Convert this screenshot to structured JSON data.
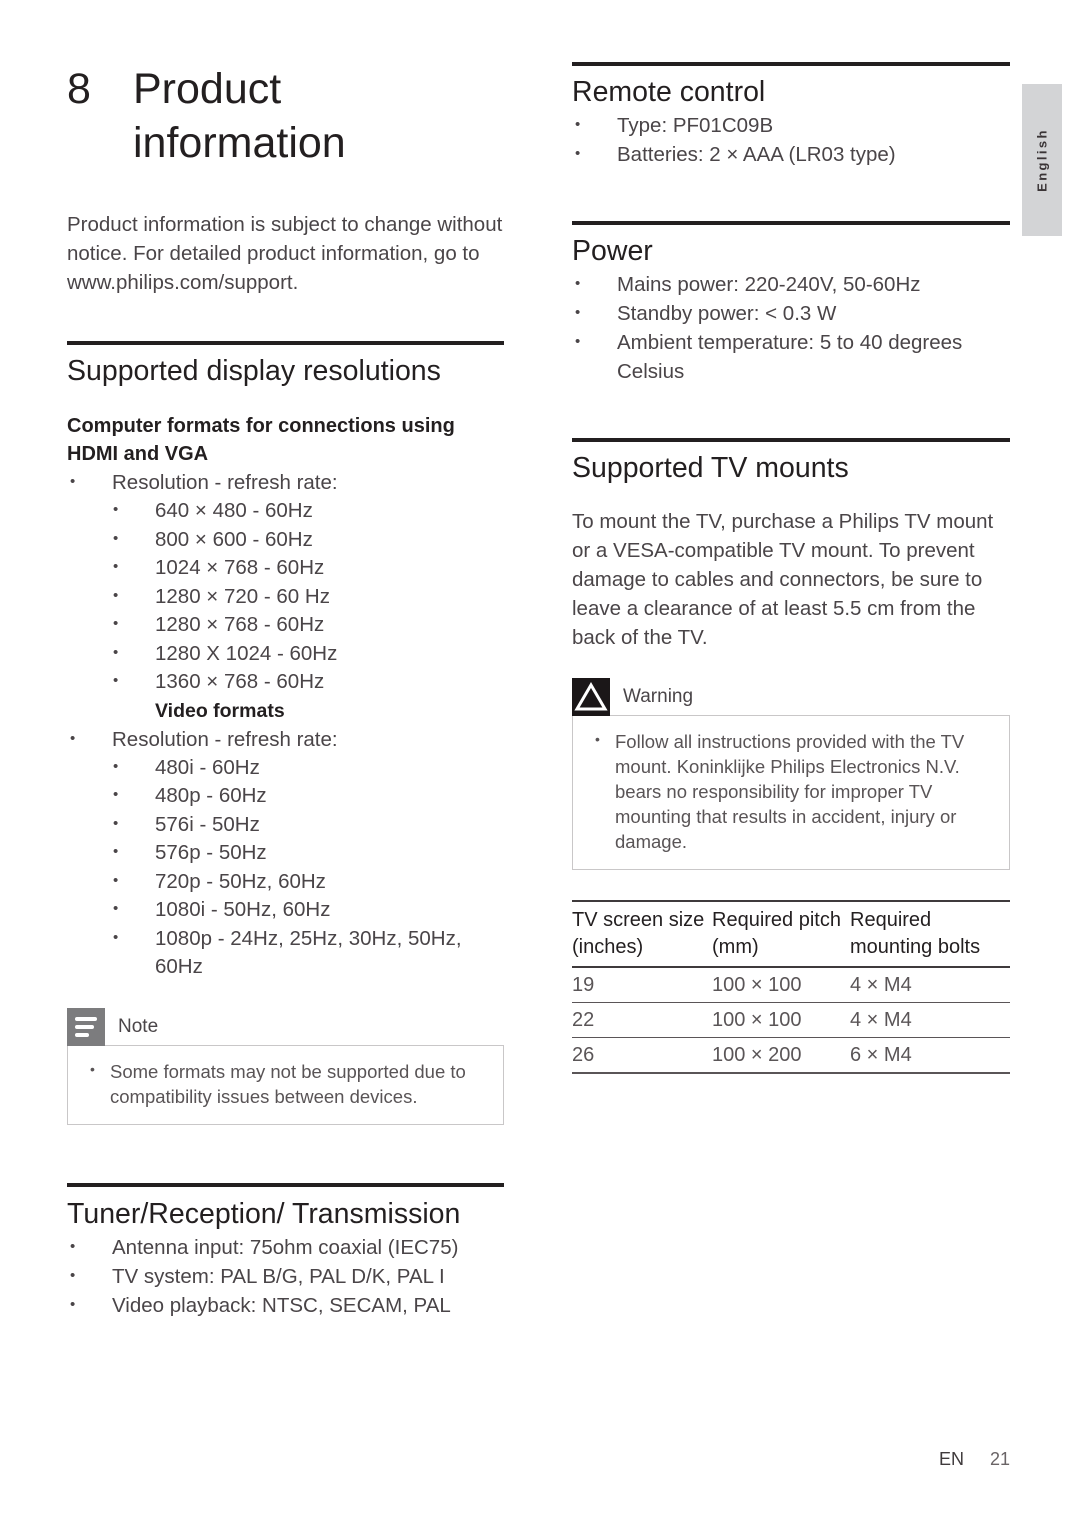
{
  "side_tab": {
    "language": "English"
  },
  "chapter": {
    "number": "8",
    "title": "Product information"
  },
  "intro": "Product information is subject to change without notice. For detailed product information, go to www.philips.com/support.",
  "left_column": {
    "display_resolutions": {
      "heading": "Supported display resolutions",
      "computer_formats": {
        "subhead": "Computer formats for connections using HDMI and VGA",
        "lead": "Resolution - refresh rate:",
        "items": [
          "640 × 480 - 60Hz",
          "800 × 600 - 60Hz",
          "1024 × 768 - 60Hz",
          "1280 × 720 - 60 Hz",
          "1280 × 768 - 60Hz",
          "1280 X 1024 - 60Hz",
          "1360 × 768 - 60Hz"
        ]
      },
      "video_formats": {
        "subhead": "Video formats",
        "lead": "Resolution - refresh rate:",
        "items": [
          "480i - 60Hz",
          "480p - 60Hz",
          "576i - 50Hz",
          "576p - 50Hz",
          "720p - 50Hz, 60Hz",
          "1080i - 50Hz, 60Hz",
          "1080p - 24Hz, 25Hz, 30Hz, 50Hz, 60Hz"
        ]
      },
      "note": {
        "icon": "note-icon",
        "label": "Note",
        "items": [
          "Some formats may not be supported due to compatibility issues between devices."
        ]
      }
    },
    "tuner": {
      "heading": "Tuner/Reception/ Transmission",
      "items": [
        "Antenna input: 75ohm coaxial (IEC75)",
        "TV system: PAL B/G, PAL D/K, PAL I",
        "Video playback: NTSC, SECAM, PAL"
      ]
    }
  },
  "right_column": {
    "remote_control": {
      "heading": "Remote control",
      "items": [
        "Type: PF01C09B",
        "Batteries: 2 × AAA (LR03 type)"
      ]
    },
    "power": {
      "heading": "Power",
      "items": [
        "Mains power: 220-240V, 50-60Hz",
        "Standby power: < 0.3 W",
        "Ambient temperature: 5 to 40 degrees Celsius"
      ]
    },
    "tv_mounts": {
      "heading": "Supported TV mounts",
      "paragraph": "To mount the TV, purchase a Philips TV mount or a VESA-compatible TV mount. To prevent damage to cables and connectors, be sure to leave a clearance of at least 5.5 cm from the back of the TV.",
      "warning": {
        "icon": "warning-icon",
        "label": "Warning",
        "items": [
          "Follow all instructions provided with the TV mount. Koninklijke Philips Electronics N.V. bears no responsibility for improper TV mounting that results in accident, injury or damage."
        ]
      },
      "table": {
        "headers": [
          "TV screen size (inches)",
          "Required pitch (mm)",
          "Required mounting bolts"
        ],
        "rows": [
          [
            "19",
            "100 × 100",
            "4 × M4"
          ],
          [
            "22",
            "100 × 100",
            "4 × M4"
          ],
          [
            "26",
            "100 × 200",
            "6 × M4"
          ]
        ]
      }
    }
  },
  "footer": {
    "language_code": "EN",
    "page_number": "21"
  },
  "colors": {
    "rule": "#231f20",
    "body_text": "#4a4548",
    "tab_background": "#d3d4d6",
    "note_icon_background": "#7c7c7e",
    "warning_icon_background": "#1b1718"
  }
}
